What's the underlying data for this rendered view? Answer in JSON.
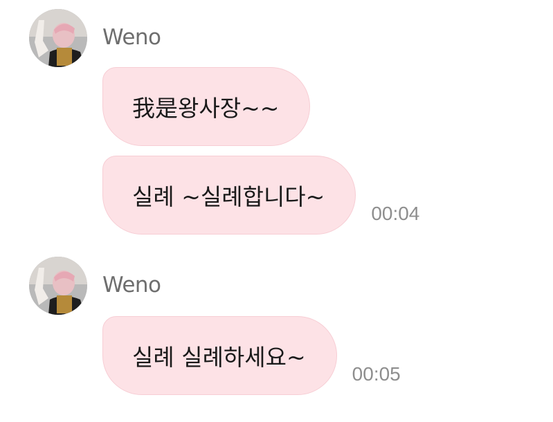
{
  "groups": [
    {
      "sender": "Weno",
      "avatar_icon": "profile-photo",
      "messages": [
        {
          "text": "我是왕사장~~",
          "time": ""
        },
        {
          "text": "실례 ~실례합니다~",
          "time": "00:04"
        }
      ]
    },
    {
      "sender": "Weno",
      "avatar_icon": "profile-photo",
      "messages": [
        {
          "text": "실례 실례하세요~",
          "time": "00:05"
        }
      ]
    }
  ],
  "colors": {
    "bubble_bg": "#fde2e6",
    "bubble_border": "#f7cdd4",
    "sender_text": "#6e6e6e",
    "time_text": "#8e8e8e"
  }
}
